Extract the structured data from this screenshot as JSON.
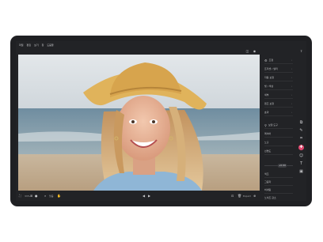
{
  "menu": [
    "파일",
    "편집",
    "보기",
    "창",
    "도움말"
  ],
  "panel_rows": [
    {
      "label": "조정",
      "icon": "adjust-icon"
    },
    {
      "label": "프리셋 / 필터",
      "icon": ""
    },
    {
      "label": "자동 보정",
      "icon": ""
    },
    {
      "label": "빛 / 색상",
      "icon": ""
    },
    {
      "label": "세부",
      "icon": ""
    },
    {
      "label": "렌즈 보정",
      "icon": ""
    },
    {
      "label": "효과",
      "icon": ""
    },
    {
      "label": "보정 도구",
      "icon": "tool-icon"
    },
    {
      "label": "레이어",
      "icon": ""
    },
    {
      "label": "노출",
      "icon": ""
    },
    {
      "label": "선명도",
      "icon": ""
    },
    {
      "label": "색조",
      "icon": ""
    },
    {
      "label": "그림자",
      "icon": ""
    },
    {
      "label": "비네팅",
      "icon": ""
    },
    {
      "label": "노이즈 감소",
      "icon": ""
    }
  ],
  "slider_value": "+0.00",
  "bottom": {
    "zoom": "33%",
    "fit_label": "맞춤",
    "export_label": "Export"
  },
  "colors": {
    "accent": "#e0476e",
    "panel": "#222326"
  }
}
